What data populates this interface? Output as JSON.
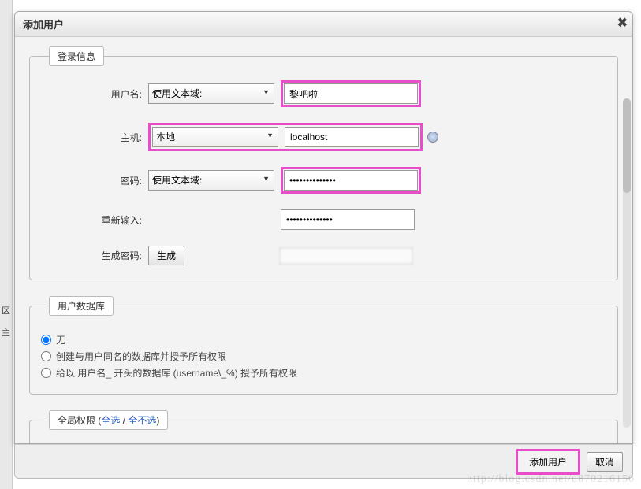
{
  "dialog": {
    "title": "添加用户",
    "close_icon": "✖"
  },
  "login_info": {
    "legend": "登录信息",
    "username": {
      "label": "用户名:",
      "select_value": "使用文本域:",
      "value": "黎吧啦"
    },
    "host": {
      "label": "主机:",
      "select_value": "本地",
      "value": "localhost"
    },
    "password": {
      "label": "密码:",
      "select_value": "使用文本域:",
      "value": "••••••••••••••"
    },
    "retype": {
      "label": "重新输入:",
      "value": "••••••••••••••"
    },
    "generate": {
      "label": "生成密码:",
      "button": "生成"
    }
  },
  "user_db": {
    "legend": "用户数据库",
    "options": [
      {
        "label": "无",
        "checked": true
      },
      {
        "label": "创建与用户同名的数据库并授予所有权限",
        "checked": false
      },
      {
        "label": "给以 用户名_ 开头的数据库 (username\\_%) 授予所有权限",
        "checked": false
      }
    ]
  },
  "global_priv": {
    "legend_prefix": "全局权限 (",
    "select_all": "全选",
    "separator": " / ",
    "deselect_all": "全不选",
    "legend_suffix": ")"
  },
  "footer": {
    "add_user": "添加用户",
    "cancel": "取消"
  },
  "watermark": "http://blog.csdn.net/u870216150",
  "side": {
    "a": "区",
    "b": "主"
  }
}
